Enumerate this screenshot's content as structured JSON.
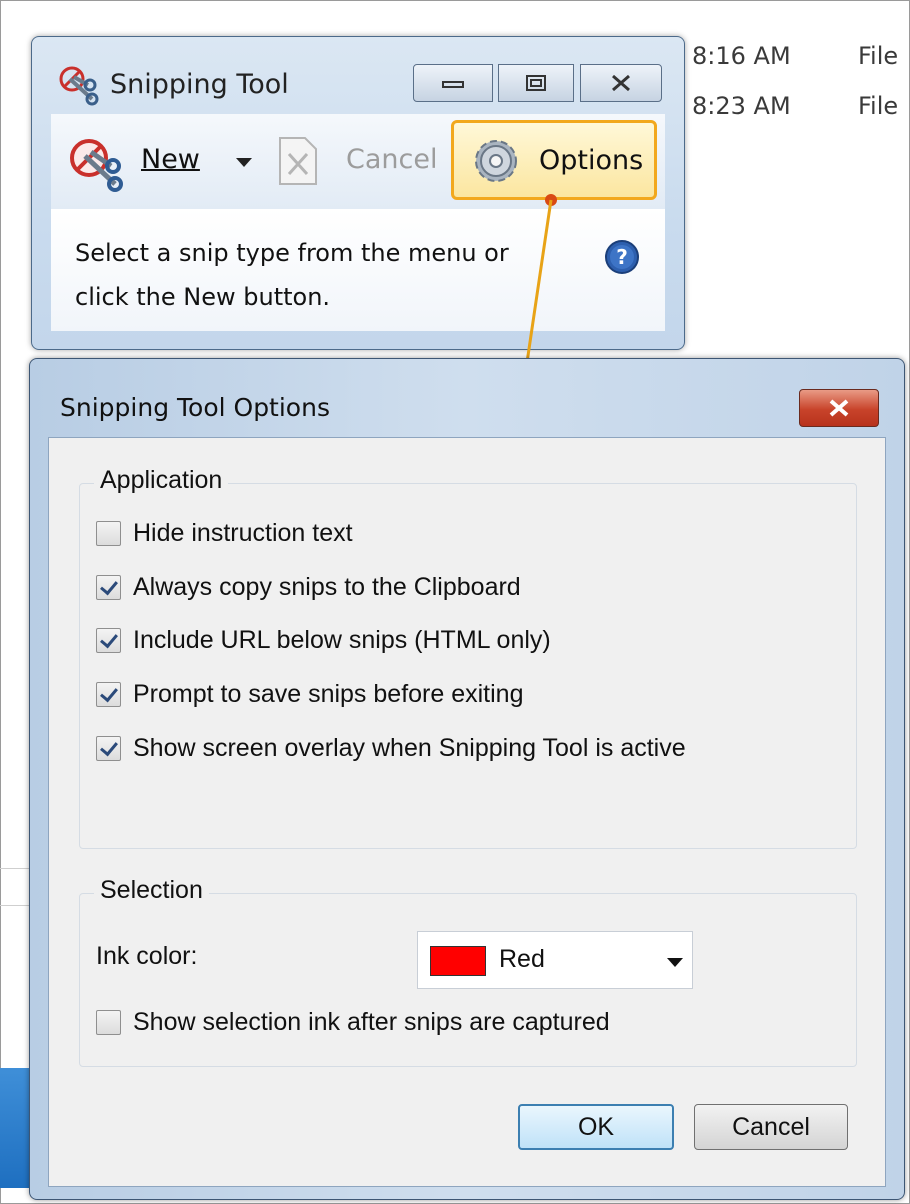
{
  "background": {
    "rows": [
      {
        "time": "8:16 AM",
        "type": "File"
      },
      {
        "time": "8:23 AM",
        "type": "File"
      }
    ]
  },
  "snipping_tool": {
    "title": "Snipping Tool",
    "toolbar": {
      "new_label": "New",
      "cancel_label": "Cancel",
      "options_label": "Options"
    },
    "instruction": "Select a snip type from the menu or click the New button."
  },
  "options_dialog": {
    "title": "Snipping Tool Options",
    "application": {
      "label": "Application",
      "options": [
        {
          "label": "Hide instruction text",
          "checked": false
        },
        {
          "label": "Always copy snips to the Clipboard",
          "checked": true
        },
        {
          "label": "Include URL below snips (HTML only)",
          "checked": true
        },
        {
          "label": "Prompt to save snips before exiting",
          "checked": true
        },
        {
          "label": "Show screen overlay when Snipping Tool is active",
          "checked": true
        }
      ]
    },
    "selection": {
      "label": "Selection",
      "ink_color_label": "Ink color:",
      "ink_color_value": "Red",
      "ink_color_swatch": "#ff0000",
      "show_ink": {
        "label": "Show selection ink after snips are captured",
        "checked": false
      }
    },
    "ok_label": "OK",
    "cancel_label": "Cancel"
  },
  "colors": {
    "highlight": "#f2a81d",
    "callout_arrow": "#e8a317",
    "callout_dot": "#d94a14"
  }
}
